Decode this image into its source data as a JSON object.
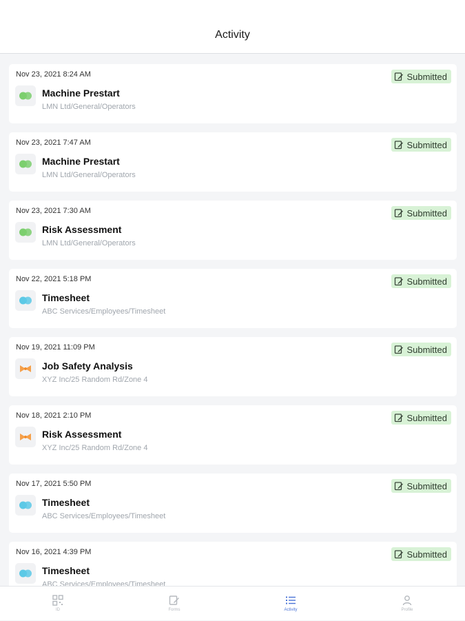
{
  "header": {
    "title": "Activity"
  },
  "status_label": "Submitted",
  "activities": [
    {
      "date": "Nov 23, 2021 8:24 AM",
      "title": "Machine Prestart",
      "path": "LMN Ltd/General/Operators",
      "icon": "green-circles-icon"
    },
    {
      "date": "Nov 23, 2021 7:47 AM",
      "title": "Machine Prestart",
      "path": "LMN Ltd/General/Operators",
      "icon": "green-circles-icon"
    },
    {
      "date": "Nov 23, 2021 7:30 AM",
      "title": "Risk Assessment",
      "path": "LMN Ltd/General/Operators",
      "icon": "green-circles-icon"
    },
    {
      "date": "Nov 22, 2021 5:18 PM",
      "title": "Timesheet",
      "path": "ABC Services/Employees/Timesheet",
      "icon": "blue-circles-icon"
    },
    {
      "date": "Nov 19, 2021 11:09 PM",
      "title": "Job Safety Analysis",
      "path": "XYZ Inc/25 Random Rd/Zone 4",
      "icon": "orange-bowtie-icon"
    },
    {
      "date": "Nov 18, 2021 2:10 PM",
      "title": "Risk Assessment",
      "path": "XYZ Inc/25 Random Rd/Zone 4",
      "icon": "orange-bowtie-icon"
    },
    {
      "date": "Nov 17, 2021 5:50 PM",
      "title": "Timesheet",
      "path": "ABC Services/Employees/Timesheet",
      "icon": "blue-circles-icon"
    },
    {
      "date": "Nov 16, 2021 4:39 PM",
      "title": "Timesheet",
      "path": "ABC Services/Employees/Timesheet",
      "icon": "blue-circles-icon"
    }
  ],
  "tabs": [
    {
      "label": "ID",
      "icon": "qr-code-icon"
    },
    {
      "label": "Forms",
      "icon": "edit-form-icon"
    },
    {
      "label": "Activity",
      "icon": "activity-list-icon"
    },
    {
      "label": "Profile",
      "icon": "person-icon"
    }
  ],
  "colors": {
    "badge_bg": "#d8f2d6",
    "green": "#7ccf6e",
    "blue": "#5cc9e6",
    "orange": "#f5a04a",
    "active_tab": "#4a73d6"
  }
}
